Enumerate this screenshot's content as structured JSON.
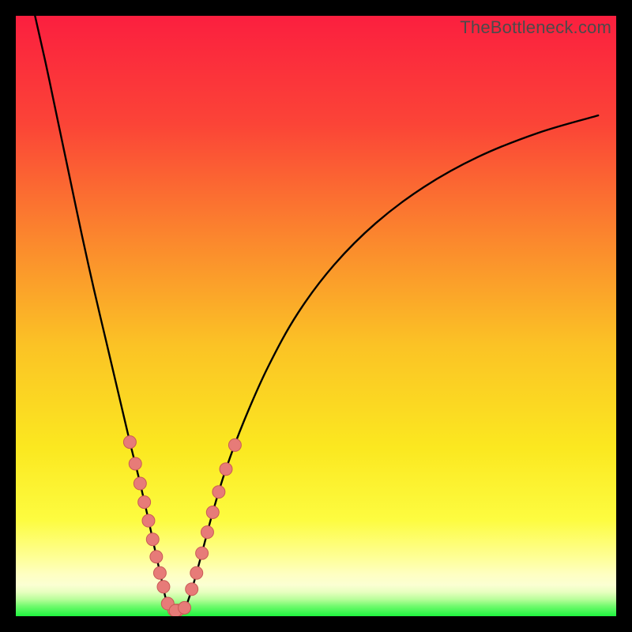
{
  "watermark": "TheBottleneck.com",
  "colors": {
    "frame": "#000000",
    "curve": "#000000",
    "bead_fill": "#e77b78",
    "bead_stroke": "#c95a56",
    "gradient_stops": [
      {
        "offset": 0.0,
        "color": "#fb1f3f"
      },
      {
        "offset": 0.18,
        "color": "#fb4437"
      },
      {
        "offset": 0.38,
        "color": "#fb8a2d"
      },
      {
        "offset": 0.55,
        "color": "#fbc325"
      },
      {
        "offset": 0.72,
        "color": "#fbe820"
      },
      {
        "offset": 0.84,
        "color": "#fdfc40"
      },
      {
        "offset": 0.905,
        "color": "#feff9a"
      },
      {
        "offset": 0.93,
        "color": "#feffc2"
      },
      {
        "offset": 0.948,
        "color": "#fbffd2"
      },
      {
        "offset": 0.96,
        "color": "#e7ffbf"
      },
      {
        "offset": 0.972,
        "color": "#b8fe9a"
      },
      {
        "offset": 0.984,
        "color": "#6dfa6b"
      },
      {
        "offset": 1.0,
        "color": "#1ef43e"
      }
    ]
  },
  "chart_data": {
    "type": "line",
    "title": "",
    "xlabel": "",
    "ylabel": "",
    "xlim": [
      0,
      100
    ],
    "ylim": [
      0,
      100
    ],
    "note": "x/y in percent of plot area; y=0 is bottom (green), y=100 is top (red). Curve is a V/funnel shape with minimum around x≈26, widening non-symmetrically.",
    "series": [
      {
        "name": "bottleneck-curve",
        "x": [
          3.2,
          5,
          7,
          9,
          11,
          13,
          15,
          17,
          19,
          20.5,
          22,
          23.3,
          24.3,
          25.2,
          26.5,
          28,
          29.2,
          30.4,
          31.6,
          33,
          35,
          38,
          42,
          47,
          53,
          60,
          68,
          77,
          87,
          97
        ],
        "y": [
          100,
          92,
          82.5,
          73,
          63.5,
          54.5,
          46,
          37.5,
          29,
          23,
          16.5,
          10.5,
          6,
          2.3,
          0.9,
          1.2,
          4.1,
          8.3,
          12.8,
          18,
          24.5,
          32.5,
          41.5,
          50.5,
          58.5,
          65.5,
          71.5,
          76.5,
          80.5,
          83.4
        ]
      }
    ],
    "beads": {
      "name": "highlight-beads",
      "radius_pct": 1.05,
      "points": [
        {
          "x": 19.0,
          "y": 29.0
        },
        {
          "x": 19.9,
          "y": 25.4
        },
        {
          "x": 20.7,
          "y": 22.1
        },
        {
          "x": 21.4,
          "y": 19.0
        },
        {
          "x": 22.1,
          "y": 15.9
        },
        {
          "x": 22.8,
          "y": 12.8
        },
        {
          "x": 23.4,
          "y": 9.9
        },
        {
          "x": 24.0,
          "y": 7.2
        },
        {
          "x": 24.6,
          "y": 4.9
        },
        {
          "x": 25.3,
          "y": 2.1
        },
        {
          "x": 26.6,
          "y": 0.9
        },
        {
          "x": 28.1,
          "y": 1.4
        },
        {
          "x": 29.3,
          "y": 4.5
        },
        {
          "x": 30.1,
          "y": 7.2
        },
        {
          "x": 31.0,
          "y": 10.5
        },
        {
          "x": 31.9,
          "y": 14.0
        },
        {
          "x": 32.8,
          "y": 17.3
        },
        {
          "x": 33.8,
          "y": 20.7
        },
        {
          "x": 35.0,
          "y": 24.5
        },
        {
          "x": 36.5,
          "y": 28.5
        }
      ]
    },
    "flat_segment": {
      "x0": 25.3,
      "x1": 28.1,
      "y": 1.0,
      "thickness_pct": 2.0
    }
  }
}
